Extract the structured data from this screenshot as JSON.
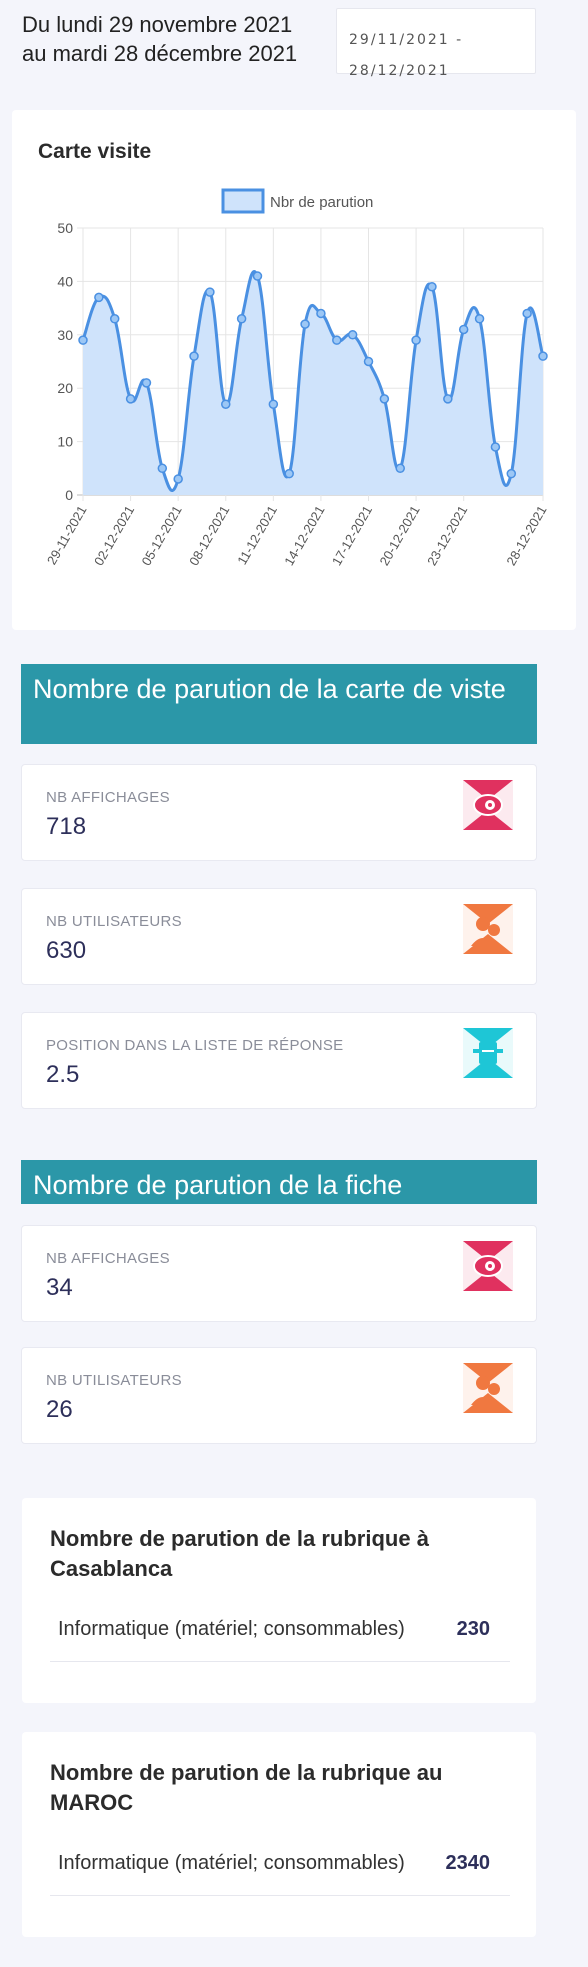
{
  "date_range": {
    "text": "Du lundi 29 novembre 2021 au mardi 28 décembre 2021",
    "start": "29/11/2021 -",
    "end": "28/12/2021"
  },
  "chart_card": {
    "title": "Carte visite"
  },
  "chart_data": {
    "type": "area",
    "title": "",
    "legend": [
      "Nbr de parution"
    ],
    "legend_position": "top",
    "grid": true,
    "ylim": [
      0,
      50
    ],
    "yticks": [
      0,
      10,
      20,
      30,
      40,
      50
    ],
    "x": [
      "29-11-2021",
      "30-11-2021",
      "01-12-2021",
      "02-12-2021",
      "03-12-2021",
      "04-12-2021",
      "05-12-2021",
      "06-12-2021",
      "07-12-2021",
      "08-12-2021",
      "09-12-2021",
      "10-12-2021",
      "11-12-2021",
      "12-12-2021",
      "13-12-2021",
      "14-12-2021",
      "15-12-2021",
      "16-12-2021",
      "17-12-2021",
      "18-12-2021",
      "19-12-2021",
      "20-12-2021",
      "21-12-2021",
      "22-12-2021",
      "23-12-2021",
      "24-12-2021",
      "25-12-2021",
      "26-12-2021",
      "27-12-2021",
      "28-12-2021"
    ],
    "xtick_labels": [
      "29-11-2021",
      "02-12-2021",
      "05-12-2021",
      "08-12-2021",
      "11-12-2021",
      "14-12-2021",
      "17-12-2021",
      "20-12-2021",
      "23-12-2021",
      "28-12-2021"
    ],
    "series": [
      {
        "name": "Nbr de parution",
        "color": "#4a90e2",
        "fill": "#cfe3fb",
        "values": [
          29,
          37,
          33,
          18,
          21,
          5,
          3,
          26,
          38,
          17,
          33,
          41,
          17,
          4,
          32,
          34,
          29,
          30,
          25,
          18,
          5,
          29,
          39,
          18,
          31,
          33,
          9,
          4,
          34,
          26
        ]
      }
    ]
  },
  "carte_section": {
    "title": "Nombre de parution de la carte de viste",
    "stats": [
      {
        "label": "NB AFFICHAGES",
        "value": "718",
        "icon": "eye-icon",
        "color": "#e0315f"
      },
      {
        "label": "NB UTILISATEURS",
        "value": "630",
        "icon": "users-icon",
        "color": "#f07840"
      },
      {
        "label": "POSITION DANS LA LISTE DE RÉPONSE",
        "value": "2.5",
        "icon": "list-position-icon",
        "color": "#1ec6d6"
      }
    ]
  },
  "fiche_section": {
    "title": "Nombre de parution de la fiche",
    "stats": [
      {
        "label": "NB AFFICHAGES",
        "value": "34",
        "icon": "eye-icon",
        "color": "#e0315f"
      },
      {
        "label": "NB UTILISATEURS",
        "value": "26",
        "icon": "users-icon",
        "color": "#f07840"
      }
    ]
  },
  "rubrique_casablanca": {
    "title": "Nombre de parution de la rubrique à Casablanca",
    "rows": [
      {
        "name": "Informatique (matériel; consommables)",
        "count": "230"
      }
    ]
  },
  "rubrique_maroc": {
    "title": "Nombre de parution de la rubrique au MAROC",
    "rows": [
      {
        "name": "Informatique (matériel; consommables)",
        "count": "2340"
      }
    ]
  }
}
